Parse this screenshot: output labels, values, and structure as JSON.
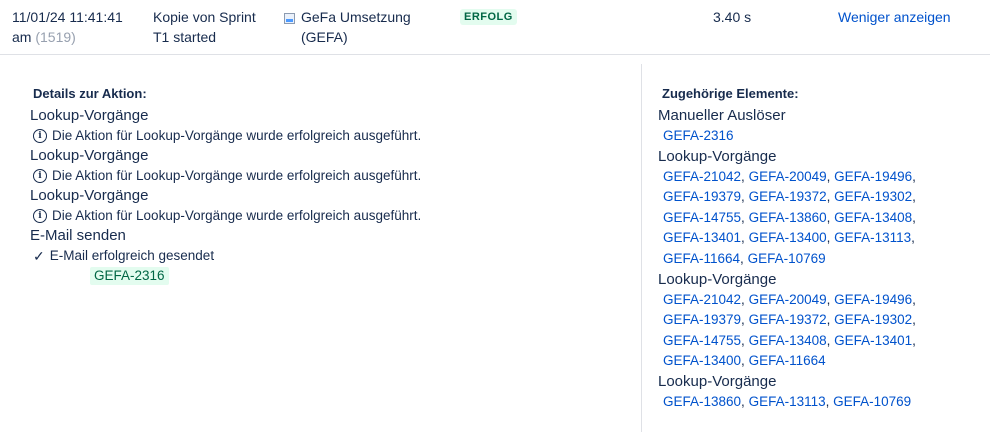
{
  "row": {
    "date": "11/01/24 11:41:41",
    "time_suffix": "am",
    "count": "(1519)",
    "rule_line1": "Kopie von Sprint",
    "rule_line2": "T1 started",
    "project_line1": "GeFa Umsetzung",
    "project_line2": "(GEFA)",
    "status": "ERFOLG",
    "duration": "3.40 s",
    "toggle": "Weniger anzeigen"
  },
  "details": {
    "title": "Details zur Aktion:",
    "actions": [
      {
        "heading": "Lookup-Vorgänge",
        "message": "Die Aktion für Lookup-Vorgänge wurde erfolgreich ausgeführt.",
        "icon": "info-icon"
      },
      {
        "heading": "Lookup-Vorgänge",
        "message": "Die Aktion für Lookup-Vorgänge wurde erfolgreich ausgeführt.",
        "icon": "info-icon"
      },
      {
        "heading": "Lookup-Vorgänge",
        "message": "Die Aktion für Lookup-Vorgänge wurde erfolgreich ausgeführt.",
        "icon": "info-icon"
      },
      {
        "heading": "E-Mail senden",
        "message": "E-Mail erfolgreich gesendet",
        "icon": "check-icon",
        "tag": "GEFA-2316"
      }
    ]
  },
  "related": {
    "title": "Zugehörige Elemente:",
    "groups": [
      {
        "heading": "Manueller Auslöser",
        "lines": [
          [
            "GEFA-2316"
          ]
        ]
      },
      {
        "heading": "Lookup-Vorgänge",
        "lines": [
          [
            "GEFA-21042",
            "GEFA-20049",
            "GEFA-19496"
          ],
          [
            "GEFA-19379",
            "GEFA-19372",
            "GEFA-19302"
          ],
          [
            "GEFA-14755",
            "GEFA-13860",
            "GEFA-13408"
          ],
          [
            "GEFA-13401",
            "GEFA-13400",
            "GEFA-13113"
          ],
          [
            "GEFA-11664",
            "GEFA-10769"
          ]
        ]
      },
      {
        "heading": "Lookup-Vorgänge",
        "lines": [
          [
            "GEFA-21042",
            "GEFA-20049",
            "GEFA-19496"
          ],
          [
            "GEFA-19379",
            "GEFA-19372",
            "GEFA-19302"
          ],
          [
            "GEFA-14755",
            "GEFA-13408",
            "GEFA-13401"
          ],
          [
            "GEFA-13400",
            "GEFA-11664"
          ]
        ]
      },
      {
        "heading": "Lookup-Vorgänge",
        "lines": [
          [
            "GEFA-13860",
            "GEFA-13113",
            "GEFA-10769"
          ]
        ]
      }
    ]
  },
  "colors": {
    "link": "#0052cc",
    "success_bg": "#e3fcef",
    "success_text": "#006644"
  }
}
